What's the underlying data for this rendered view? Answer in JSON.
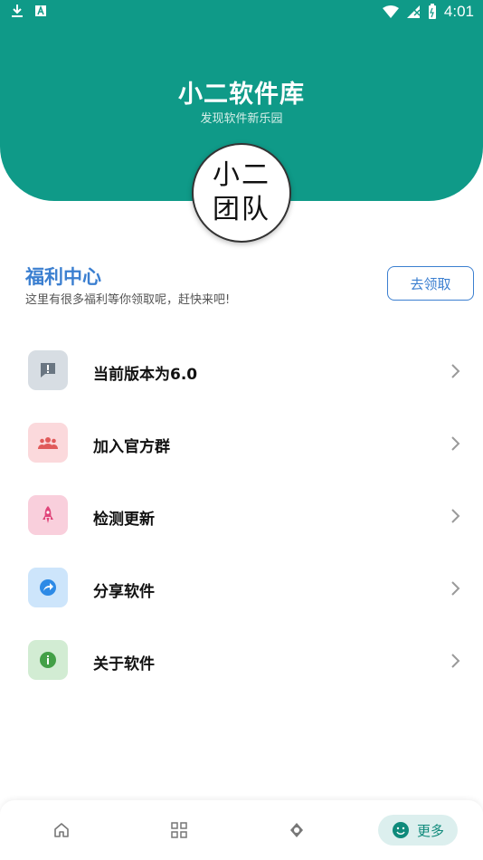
{
  "status_bar": {
    "time": "4:01"
  },
  "header": {
    "title": "小二软件库",
    "subtitle": "发现软件新乐园"
  },
  "logo": {
    "line1": "小二",
    "line2": "团队"
  },
  "welfare": {
    "title": "福利中心",
    "description": "这里有很多福利等你领取呢，赶快来吧!",
    "button_label": "去领取"
  },
  "menu": {
    "items": [
      {
        "label": "当前版本为6.0",
        "icon": "alert-message-icon",
        "bg": "#d7dde3",
        "fg": "#6a7682"
      },
      {
        "label": "加入官方群",
        "icon": "group-icon",
        "bg": "#fbd9dc",
        "fg": "#e05a5a"
      },
      {
        "label": "检测更新",
        "icon": "rocket-icon",
        "bg": "#f9cfdc",
        "fg": "#e0457a"
      },
      {
        "label": "分享软件",
        "icon": "share-icon",
        "bg": "#cde5fb",
        "fg": "#2d8ae6"
      },
      {
        "label": "关于软件",
        "icon": "info-icon",
        "bg": "#d2ecd3",
        "fg": "#43a047"
      }
    ]
  },
  "bottom_nav": {
    "items": [
      {
        "icon": "home-icon"
      },
      {
        "icon": "grid-icon"
      },
      {
        "icon": "discover-icon"
      },
      {
        "icon": "smiley-icon",
        "label": "更多",
        "active": true
      }
    ]
  },
  "colors": {
    "primary": "#0f9a88",
    "accent_blue": "#3b7fd0",
    "nav_active_bg": "#dcefee"
  }
}
